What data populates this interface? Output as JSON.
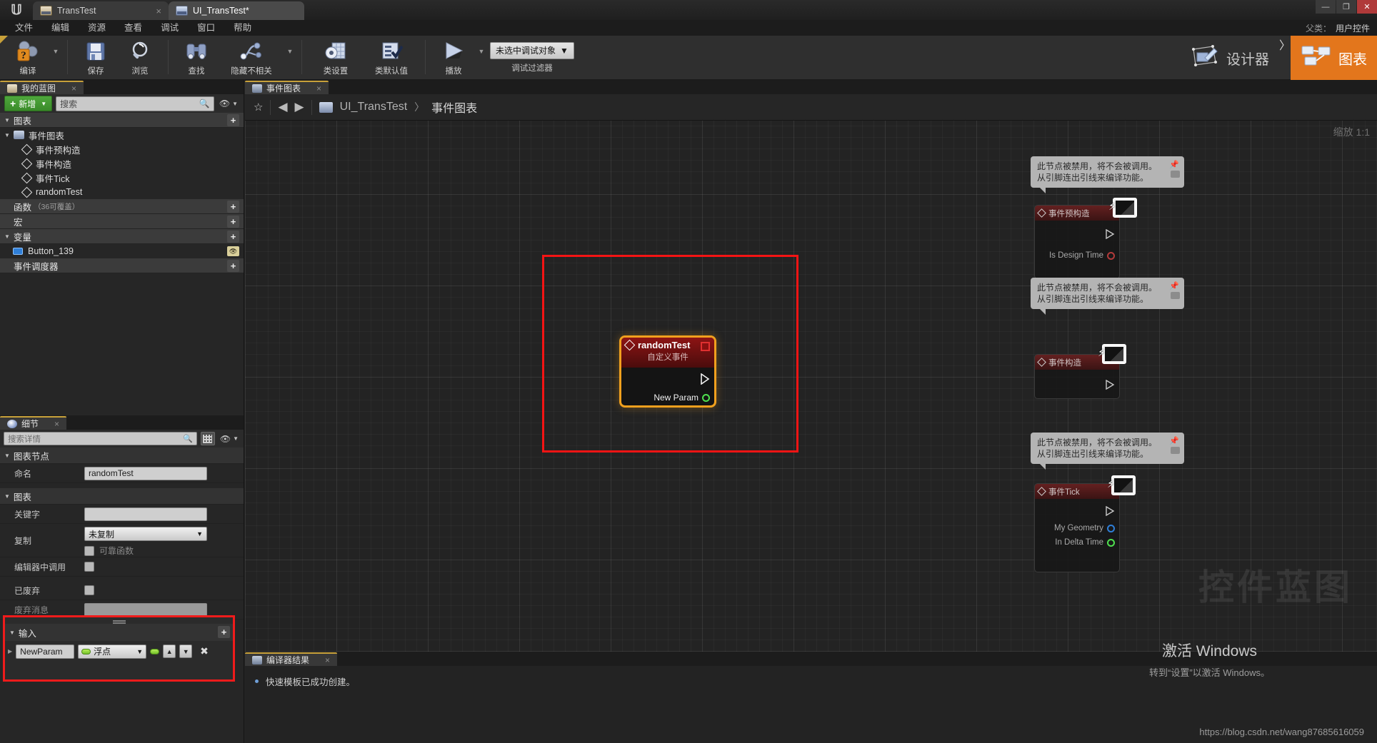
{
  "window": {
    "tabs": [
      {
        "label": "TransTest",
        "icon": "book-icon",
        "active": false,
        "close": "×"
      },
      {
        "label": "UI_TransTest*",
        "icon": "widget-icon",
        "active": true,
        "close": ""
      }
    ],
    "buttons": {
      "minimize": "—",
      "maximize": "❐",
      "close": "✕"
    },
    "logo": "unreal-logo"
  },
  "menu": {
    "items": [
      "文件",
      "编辑",
      "资源",
      "查看",
      "调试",
      "窗口",
      "帮助"
    ],
    "right_label": "父类：",
    "right_value": "用户控件"
  },
  "toolbar": {
    "compile": {
      "label": "编译",
      "icon": "compile-gear-question-icon"
    },
    "save": {
      "label": "保存",
      "icon": "floppy-disk-icon"
    },
    "browse": {
      "label": "浏览",
      "icon": "magnifier-icon"
    },
    "find": {
      "label": "查找",
      "icon": "binoculars-icon"
    },
    "hide_unrelated": {
      "label": "隐藏不相关",
      "icon": "node-graph-icon"
    },
    "class_settings": {
      "label": "类设置",
      "icon": "gear-grid-icon"
    },
    "class_defaults": {
      "label": "类默认值",
      "icon": "checklist-icon"
    },
    "play": {
      "label": "播放",
      "icon": "play-triangle-icon"
    },
    "debug_object": "未选中调试对象",
    "debug_filter_label": "调试过滤器"
  },
  "modeswitch": {
    "designer": {
      "label": "设计器",
      "icon": "designer-icon",
      "active": false
    },
    "graph": {
      "label": "图表",
      "icon": "graph-icon",
      "active": true
    },
    "separator": "〉"
  },
  "myblueprint": {
    "tab": {
      "label": "我的蓝图",
      "icon": "book-icon",
      "close": "×"
    },
    "add_button": "新增",
    "search_placeholder": "搜索",
    "sections": {
      "graphs": {
        "label": "图表",
        "add": "+"
      },
      "functions": {
        "label": "函数",
        "sub": "（36可覆盖）",
        "add": "+"
      },
      "macros": {
        "label": "宏",
        "add": "+"
      },
      "variables": {
        "label": "变量",
        "add": "+"
      },
      "dispatchers": {
        "label": "事件调度器",
        "add": "+"
      }
    },
    "event_graph": "事件图表",
    "graph_nodes": [
      "事件预构造",
      "事件构造",
      "事件Tick",
      "randomTest"
    ],
    "variables": [
      {
        "name": "Button_139",
        "icon": "button-widget-icon"
      }
    ]
  },
  "details": {
    "tab": {
      "label": "细节",
      "icon": "details-icon",
      "close": "×"
    },
    "search_placeholder": "搜索详情",
    "categories": [
      {
        "label": "图表节点",
        "rows": [
          {
            "key": "命名",
            "type": "text",
            "value": "randomTest"
          }
        ]
      },
      {
        "label": "图表",
        "rows": [
          {
            "key": "关键字",
            "type": "text",
            "value": ""
          },
          {
            "key": "复制",
            "type": "select",
            "value": "未复制",
            "extra_label": "可靠函数",
            "extra_type": "checkbox"
          },
          {
            "key": "编辑器中调用",
            "type": "checkbox",
            "value": ""
          },
          {
            "key": "已废弃",
            "type": "checkbox",
            "value": ""
          },
          {
            "key": "废弃消息",
            "type": "text-disabled",
            "value": ""
          }
        ]
      }
    ],
    "input_section": {
      "label": "输入",
      "add": "+",
      "param_name": "NewParam",
      "param_type": "浮点",
      "move_up": "▲",
      "move_down": "▼",
      "remove": "✖"
    }
  },
  "graph": {
    "tab": {
      "label": "事件图表",
      "icon": "graph-icon",
      "close": "×"
    },
    "breadcrumb": {
      "star": "☆",
      "back": "◀",
      "forward": "▶",
      "root": "UI_TransTest",
      "chevron": "〉",
      "current": "事件图表"
    },
    "zoom": "缩放 1:1",
    "nodes": {
      "custom_event": {
        "title": "randomTest",
        "subtitle": "自定义事件",
        "output_param": "New Param"
      },
      "disabled": [
        {
          "title": "事件预构造",
          "pins": [
            {
              "label": "Is Design Time",
              "color": "red"
            }
          ],
          "tooltip": "此节点被禁用，将不会被调用。\n从引脚连出引线来编译功能。"
        },
        {
          "title": "事件构造",
          "pins": [],
          "tooltip": "此节点被禁用，将不会被调用。\n从引脚连出引线来编译功能。"
        },
        {
          "title": "事件Tick",
          "pins": [
            {
              "label": "My Geometry",
              "color": "blue"
            },
            {
              "label": "In Delta Time",
              "color": "green"
            }
          ],
          "tooltip": "此节点被禁用，将不会被调用。\n从引脚连出引线来编译功能。"
        }
      ]
    },
    "watermark": "控件蓝图"
  },
  "compiler": {
    "tab": {
      "label": "编译器结果",
      "icon": "compiler-icon",
      "close": "×"
    },
    "messages": [
      "快速模板已成功创建。"
    ]
  },
  "overlay": {
    "activate_title": "激活 Windows",
    "activate_sub": "转到“设置”以激活 Windows。",
    "url": "https://blog.csdn.net/wang87685616059"
  },
  "colors": {
    "accent_orange": "#e3761c",
    "highlight_red": "#f41414",
    "node_border": "#f0a01e",
    "add_green": "#4fa83c"
  }
}
